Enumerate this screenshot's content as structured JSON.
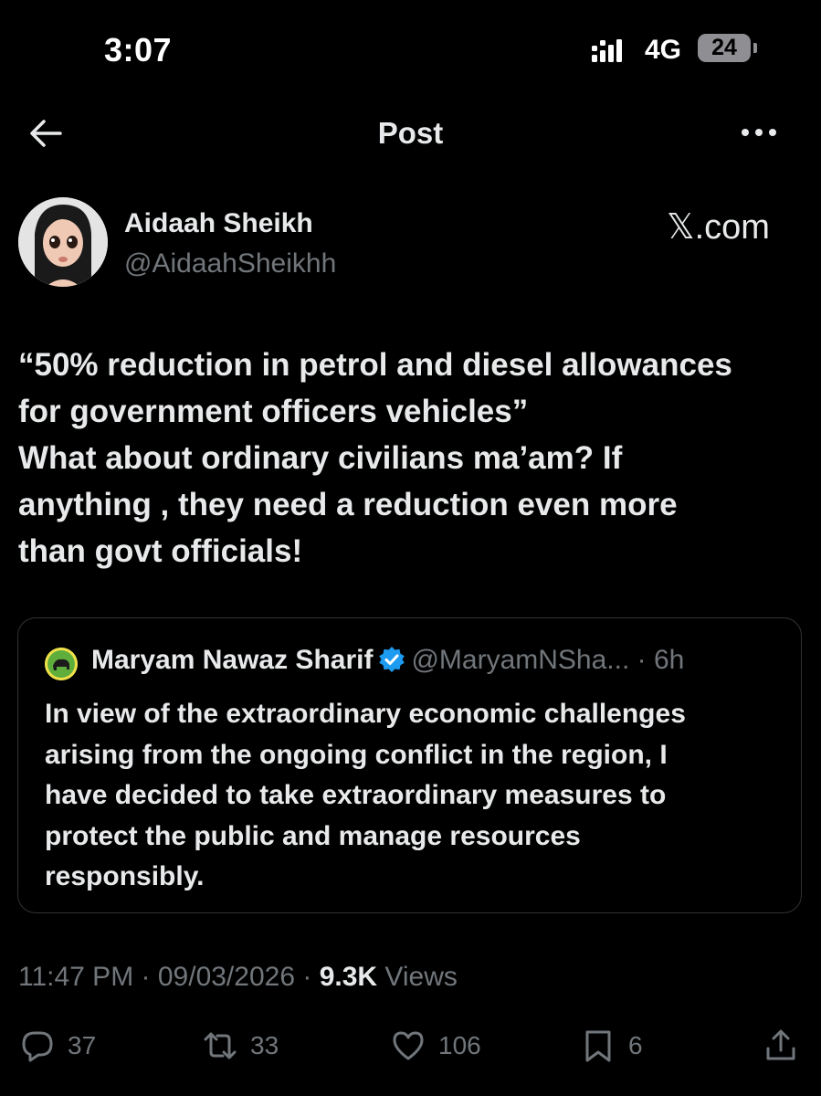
{
  "status_bar": {
    "time": "3:07",
    "network": "4G",
    "battery": "24"
  },
  "header": {
    "title": "Post"
  },
  "author": {
    "name": "Aidaah Sheikh",
    "handle": "@AidaahSheikhh",
    "brand": "𝕏.com"
  },
  "post": {
    "lines": [
      "“50% reduction in petrol and diesel allowances",
      "for government officers vehicles”",
      "What about ordinary civilians ma’am? If",
      "anything , they need a reduction even more",
      "than govt officials!"
    ]
  },
  "quote": {
    "name": "Maryam Nawaz Sharif",
    "handle": "@MaryamNSha...",
    "dot": " · ",
    "time": "6h",
    "lines": [
      "In view of the extraordinary economic challenges",
      "arising from the ongoing conflict in the region, I",
      "have decided to take extraordinary measures to",
      "protect the public and manage resources",
      "responsibly."
    ]
  },
  "meta": {
    "time": "11:47 PM",
    "sep1": " · ",
    "date": "09/03/2026",
    "sep2": " · ",
    "views_count": "9.3K",
    "views_label": " Views"
  },
  "actions": {
    "replies": "37",
    "reposts": "33",
    "likes": "106",
    "bookmarks": "6"
  },
  "colors": {
    "background": "#000000",
    "text": "#e7e9ea",
    "muted": "#71767b",
    "verified": "#1d9bf0",
    "border": "#2f3336"
  }
}
